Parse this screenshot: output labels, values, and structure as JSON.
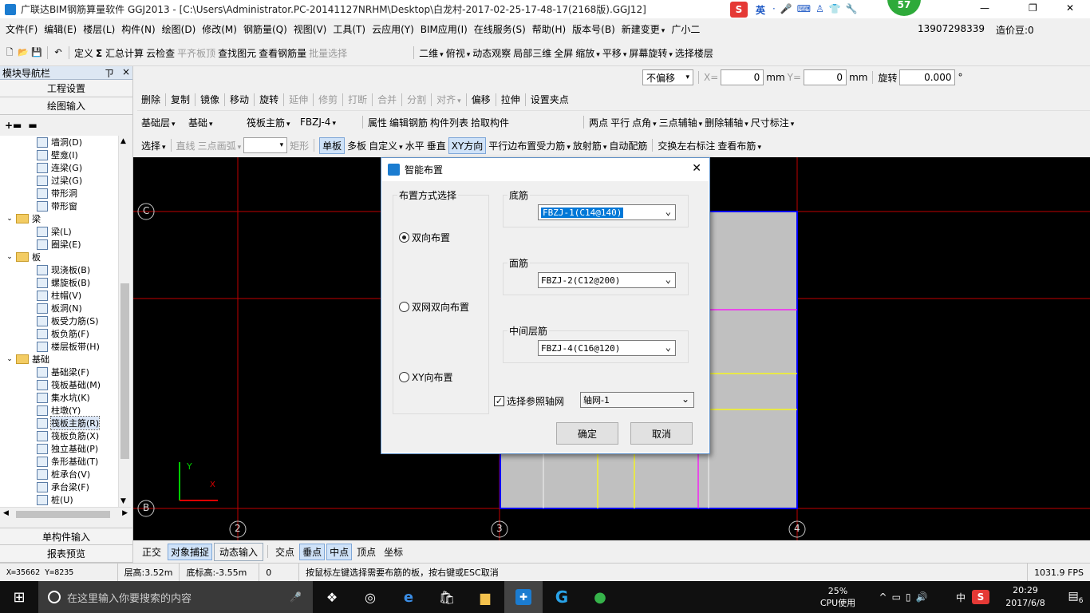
{
  "window": {
    "title": "广联达BIM钢筋算量软件 GGJ2013 - [C:\\Users\\Administrator.PC-20141127NRHM\\Desktop\\白龙村-2017-02-25-17-48-17(2168版).GGJ12]",
    "min": "—",
    "max": "❐",
    "close": "✕",
    "badge": "57",
    "ime_lang": "英"
  },
  "menu": [
    "文件(F)",
    "编辑(E)",
    "楼层(L)",
    "构件(N)",
    "绘图(D)",
    "修改(M)",
    "钢筋量(Q)",
    "视图(V)",
    "工具(T)",
    "云应用(Y)",
    "BIM应用(I)",
    "在线服务(S)",
    "帮助(H)",
    "版本号(B)",
    "新建变更",
    "广小二"
  ],
  "account": {
    "phone": "13907298339",
    "points": "造价豆:0"
  },
  "toolbar1": {
    "items": [
      "定义",
      "汇总计算",
      "云检查",
      "平齐板顶",
      "查找图元",
      "查看钢筋量",
      "批量选择",
      "二维",
      "俯视",
      "动态观察",
      "局部三维",
      "全屏",
      "缩放",
      "平移",
      "屏幕旋转",
      "选择楼层"
    ]
  },
  "nav": {
    "title": "模块导航栏",
    "pin": "ㄗ",
    "close": "×",
    "btn_project": "工程设置",
    "btn_draw": "绘图输入",
    "btn_single": "单构件输入",
    "btn_report": "报表预览",
    "tree": [
      {
        "t": "墙洞(D)",
        "k": "item"
      },
      {
        "t": "壁龛(I)",
        "k": "item"
      },
      {
        "t": "连梁(G)",
        "k": "item"
      },
      {
        "t": "过梁(G)",
        "k": "item"
      },
      {
        "t": "带形洞",
        "k": "item"
      },
      {
        "t": "带形窗",
        "k": "item"
      },
      {
        "t": "梁",
        "k": "cat"
      },
      {
        "t": "梁(L)",
        "k": "item"
      },
      {
        "t": "圈梁(E)",
        "k": "item"
      },
      {
        "t": "板",
        "k": "cat"
      },
      {
        "t": "现浇板(B)",
        "k": "item"
      },
      {
        "t": "螺旋板(B)",
        "k": "item"
      },
      {
        "t": "柱帽(V)",
        "k": "item"
      },
      {
        "t": "板洞(N)",
        "k": "item"
      },
      {
        "t": "板受力筋(S)",
        "k": "item"
      },
      {
        "t": "板负筋(F)",
        "k": "item"
      },
      {
        "t": "楼层板带(H)",
        "k": "item"
      },
      {
        "t": "基础",
        "k": "cat"
      },
      {
        "t": "基础梁(F)",
        "k": "item"
      },
      {
        "t": "筏板基础(M)",
        "k": "item"
      },
      {
        "t": "集水坑(K)",
        "k": "item"
      },
      {
        "t": "柱墩(Y)",
        "k": "item"
      },
      {
        "t": "筏板主筋(R)",
        "k": "sel"
      },
      {
        "t": "筏板负筋(X)",
        "k": "item"
      },
      {
        "t": "独立基础(P)",
        "k": "item"
      },
      {
        "t": "条形基础(T)",
        "k": "item"
      },
      {
        "t": "桩承台(V)",
        "k": "item"
      },
      {
        "t": "承台梁(F)",
        "k": "item"
      },
      {
        "t": "桩(U)",
        "k": "item"
      }
    ]
  },
  "row2": {
    "offset_mode": "不偏移",
    "x_label": "X=",
    "x_val": "0",
    "y_label": "Y=",
    "y_val": "0",
    "unit": "mm",
    "rotate_label": "旋转",
    "rotate_val": "0.000",
    "deg": "°"
  },
  "row3": [
    "删除",
    "复制",
    "镜像",
    "移动",
    "旋转",
    "延伸",
    "修剪",
    "打断",
    "合并",
    "分割",
    "对齐",
    "偏移",
    "拉伸",
    "设置夹点"
  ],
  "row4": {
    "layer": "基础层",
    "type": "基础",
    "comp": "筏板主筋",
    "name": "FBZJ-4",
    "items": [
      "属性",
      "编辑钢筋",
      "构件列表",
      "拾取构件"
    ],
    "right": [
      "两点",
      "平行",
      "点角",
      "三点辅轴",
      "删除辅轴",
      "尺寸标注"
    ]
  },
  "row5": [
    "选择",
    "直线",
    "三点画弧",
    "矩形",
    "单板",
    "多板",
    "自定义",
    "水平",
    "垂直",
    "XY方向",
    "平行边布置受力筋",
    "放射筋",
    "自动配筋",
    "交换左右标注",
    "查看布筋"
  ],
  "axes": {
    "labels": [
      "C",
      "B",
      "2",
      "3",
      "4"
    ],
    "x": "X",
    "y": "Y"
  },
  "status_row": [
    "正交",
    "对象捕捉",
    "动态输入",
    "交点",
    "垂点",
    "中点",
    "顶点",
    "坐标"
  ],
  "bottom": {
    "coords": "X=35662 Y=8235",
    "floor_h": "层高:3.52m",
    "base_h": "底标高:-3.55m",
    "zero": "0",
    "hint": "按鼠标左键选择需要布筋的板，按右键或ESC取消",
    "fps": "1031.9 FPS"
  },
  "dialog": {
    "title": "智能布置",
    "close": "✕",
    "mode_group": "布置方式选择",
    "radio1": "双向布置",
    "radio2": "双网双向布置",
    "radio3": "XY向布置",
    "bottom_group": "底筋",
    "bottom_val": "FBZJ-1(C14@140)",
    "top_group": "面筋",
    "top_val": "FBZJ-2(C12@200)",
    "mid_group": "中间层筋",
    "mid_val": "FBZJ-4(C16@120)",
    "check_label": "选择参照轴网",
    "axis_val": "轴网-1",
    "ok": "确定",
    "cancel": "取消"
  },
  "taskbar": {
    "search": "在这里输入你要搜索的内容",
    "cpu_pct": "25%",
    "cpu_label": "CPU使用",
    "ime": "中",
    "time": "20:29",
    "date": "2017/6/8",
    "notif": "6"
  }
}
